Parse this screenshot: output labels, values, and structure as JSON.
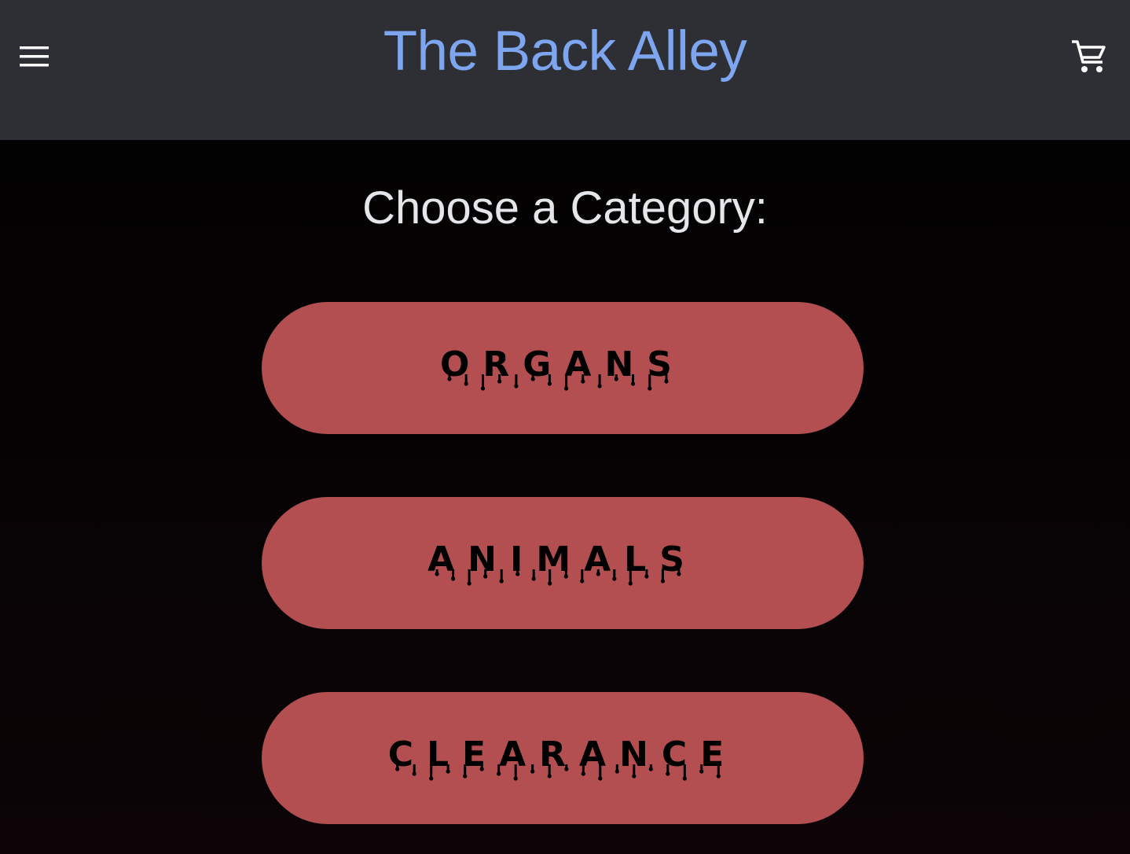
{
  "header": {
    "title": "The Back Alley",
    "menu_icon": "hamburger-menu-icon",
    "cart_icon": "shopping-cart-icon",
    "background_color": "#2d2f34",
    "title_color": "#7ea6f0"
  },
  "main": {
    "heading": "Choose a Category:",
    "categories": [
      {
        "label": "ORGANS"
      },
      {
        "label": "ANIMALS"
      },
      {
        "label": "CLEARANCE"
      }
    ],
    "button_color": "#b44f51"
  }
}
